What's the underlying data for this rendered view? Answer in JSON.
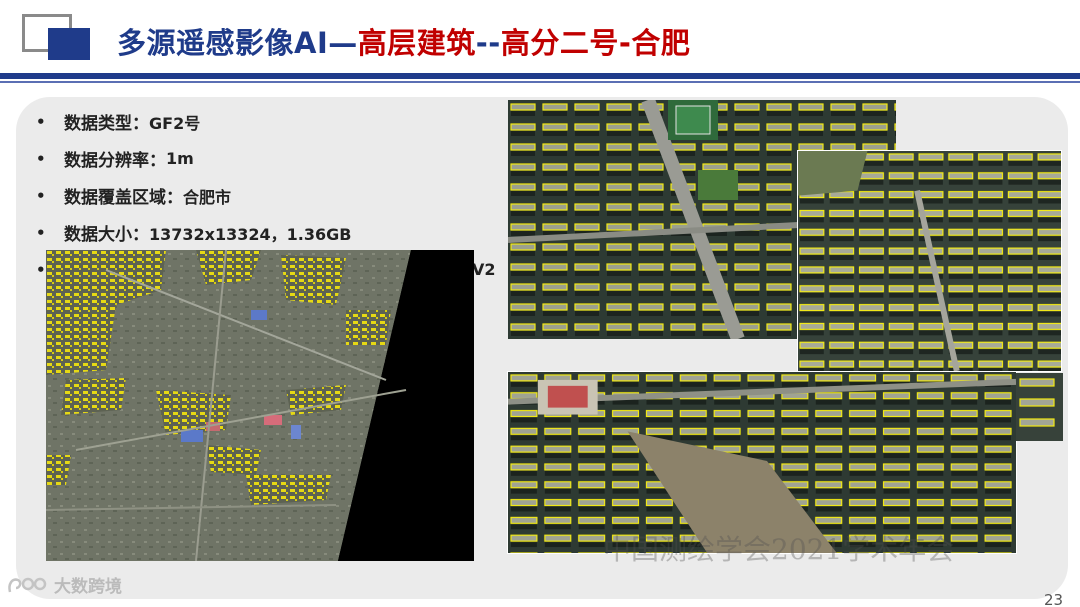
{
  "header": {
    "title_blue_1": "多源遥感影像AI—",
    "title_red_1": "高层建筑",
    "title_blue_2": "--",
    "title_red_2": "高分二号-合肥",
    "colors": {
      "blue": "#1f3b8a",
      "red": "#c00000"
    }
  },
  "bullets": [
    {
      "label": "数据类型：",
      "value": "GF2号"
    },
    {
      "label": "数据分辨率：",
      "value": "1m"
    },
    {
      "label": "数据覆盖区域：",
      "value": "合肥市"
    },
    {
      "label": "数据大小：",
      "value": "13732x13324，1.36GB"
    },
    {
      "label": "",
      "value": "V2"
    }
  ],
  "bullet_glyph": "•",
  "images": {
    "main_map": "hefei-building-detection-overview-map",
    "detail_a": "residential-blocks-detected-buildings",
    "detail_b": "high-rise-cluster-detected-buildings",
    "detail_c": "residential-area-detected-buildings",
    "detail_d": "detected-buildings-crop"
  },
  "footer": {
    "watermark": "中国测绘学会2021学术年会",
    "brand": "大数跨境",
    "page_number": "23"
  }
}
